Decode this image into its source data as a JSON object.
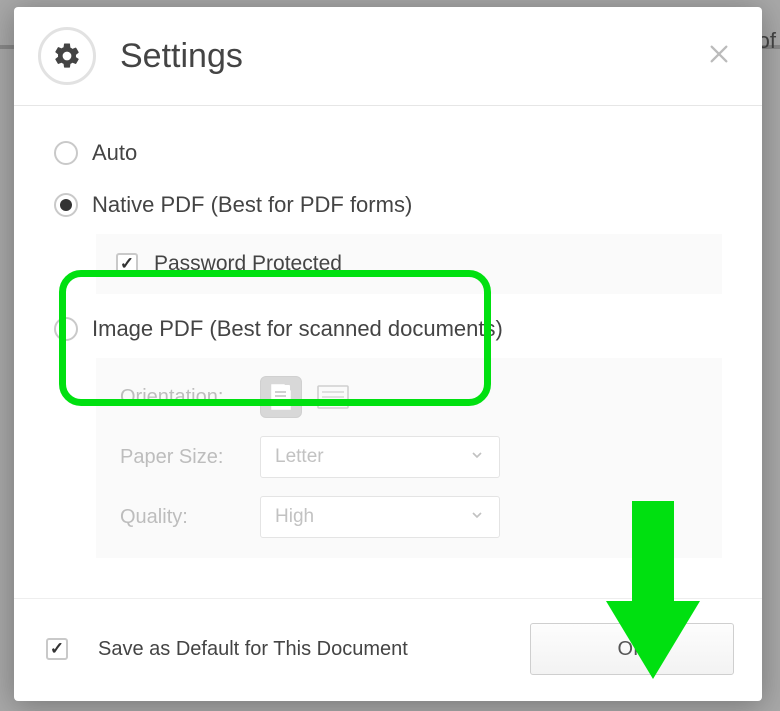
{
  "bg_fragment": "of",
  "header": {
    "title": "Settings"
  },
  "options": {
    "auto": {
      "label": "Auto",
      "selected": false
    },
    "native": {
      "label": "Native PDF (Best for PDF forms)",
      "selected": true,
      "password_protected": {
        "label": "Password Protected",
        "checked": true
      }
    },
    "image": {
      "label": "Image PDF (Best for scanned documents)",
      "selected": false,
      "orientation": {
        "label": "Orientation:",
        "value": "portrait"
      },
      "paper_size": {
        "label": "Paper Size:",
        "value": "Letter"
      },
      "quality": {
        "label": "Quality:",
        "value": "High"
      }
    }
  },
  "footer": {
    "save_default": {
      "label": "Save as Default for This Document",
      "checked": true
    },
    "ok": "OK"
  },
  "annotation": {
    "highlight_color": "#00e010",
    "arrow_color": "#00e010"
  }
}
